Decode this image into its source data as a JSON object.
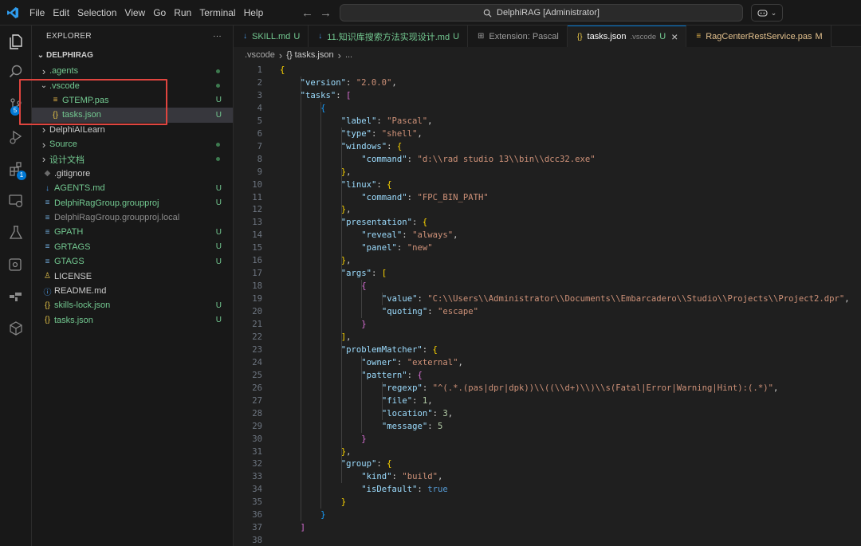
{
  "titlebar": {
    "menu": [
      "File",
      "Edit",
      "Selection",
      "View",
      "Go",
      "Run",
      "Terminal",
      "Help"
    ],
    "search_text": "DelphiRAG [Administrator]"
  },
  "activity_bar": {
    "source_control_badge": "5",
    "extensions_badge": "1"
  },
  "sidebar": {
    "title": "EXPLORER",
    "more_label": "···",
    "root": "DELPHIRAG",
    "items": [
      {
        "label": ".agents",
        "kind": "folder",
        "expanded": false,
        "indent": 0,
        "color": "#73c991",
        "status": "dot"
      },
      {
        "label": ".vscode",
        "kind": "folder",
        "expanded": true,
        "indent": 0,
        "color": "#73c991",
        "status": "dot"
      },
      {
        "label": "GTEMP.pas",
        "kind": "pas",
        "indent": 1,
        "color": "#73c991",
        "status": "U"
      },
      {
        "label": "tasks.json",
        "kind": "json",
        "indent": 1,
        "color": "#73c991",
        "status": "U",
        "selected": true
      },
      {
        "label": "DelphiAILearn",
        "kind": "folder",
        "expanded": false,
        "indent": 0,
        "color": "#cccccc",
        "status": ""
      },
      {
        "label": "Source",
        "kind": "folder",
        "expanded": false,
        "indent": 0,
        "color": "#73c991",
        "status": "dot"
      },
      {
        "label": "设计文档",
        "kind": "folder",
        "expanded": false,
        "indent": 0,
        "color": "#73c991",
        "status": "dot"
      },
      {
        "label": ".gitignore",
        "kind": "gitignore",
        "indent": 0,
        "color": "#cccccc",
        "status": ""
      },
      {
        "label": "AGENTS.md",
        "kind": "md",
        "indent": 0,
        "color": "#73c991",
        "status": "U"
      },
      {
        "label": "DelphiRagGroup.groupproj",
        "kind": "proj",
        "indent": 0,
        "color": "#73c991",
        "status": "U"
      },
      {
        "label": "DelphiRagGroup.groupproj.local",
        "kind": "file",
        "indent": 0,
        "color": "#8c8c8c",
        "status": ""
      },
      {
        "label": "GPATH",
        "kind": "file",
        "indent": 0,
        "color": "#73c991",
        "status": "U"
      },
      {
        "label": "GRTAGS",
        "kind": "file",
        "indent": 0,
        "color": "#73c991",
        "status": "U"
      },
      {
        "label": "GTAGS",
        "kind": "file",
        "indent": 0,
        "color": "#73c991",
        "status": "U"
      },
      {
        "label": "LICENSE",
        "kind": "license",
        "indent": 0,
        "color": "#cccccc",
        "status": ""
      },
      {
        "label": "README.md",
        "kind": "info",
        "indent": 0,
        "color": "#cccccc",
        "status": ""
      },
      {
        "label": "skills-lock.json",
        "kind": "json",
        "indent": 0,
        "color": "#73c991",
        "status": "U"
      },
      {
        "label": "tasks.json",
        "kind": "json",
        "indent": 0,
        "color": "#73c991",
        "status": "U"
      }
    ]
  },
  "tabs": [
    {
      "label": "SKILL.md",
      "status": "U",
      "icon": "md",
      "status_color": "#73c991",
      "label_color": "#73c991"
    },
    {
      "label": "11.知识库搜索方法实现设计.md",
      "status": "U",
      "icon": "md",
      "status_color": "#73c991",
      "label_color": "#73c991"
    },
    {
      "label": "Extension: Pascal",
      "status": "",
      "icon": "ext",
      "status_color": "",
      "label_color": "#9d9d9d"
    },
    {
      "label": "tasks.json",
      "description": ".vscode",
      "status": "U",
      "icon": "json",
      "active": true,
      "status_color": "#73c991",
      "label_color": "#ffffff"
    },
    {
      "label": "RagCenterRestService.pas",
      "status": "M",
      "icon": "pas",
      "status_color": "#e2c08d",
      "label_color": "#e2c08d"
    }
  ],
  "breadcrumb": [
    ".vscode",
    "{} tasks.json",
    "..."
  ],
  "code_lines": [
    "{",
    "    \"version\": \"2.0.0\",",
    "    \"tasks\": [",
    "        {",
    "            \"label\": \"Pascal\",",
    "            \"type\": \"shell\",",
    "            \"windows\": {",
    "                \"command\": \"d:\\\\rad studio 13\\\\bin\\\\dcc32.exe\"",
    "            },",
    "            \"linux\": {",
    "                \"command\": \"FPC_BIN_PATH\"",
    "            },",
    "            \"presentation\": {",
    "                \"reveal\": \"always\",",
    "                \"panel\": \"new\"",
    "            },",
    "            \"args\": [",
    "                {",
    "                    \"value\": \"C:\\\\Users\\\\Administrator\\\\Documents\\\\Embarcadero\\\\Studio\\\\Projects\\\\Project2.dpr\",",
    "                    \"quoting\": \"escape\"",
    "                }",
    "            ],",
    "            \"problemMatcher\": {",
    "                \"owner\": \"external\",",
    "                \"pattern\": {",
    "                    \"regexp\": \"^(.*.(pas|dpr|dpk))\\\\((\\\\d+)\\\\)\\\\s(Fatal|Error|Warning|Hint):(.*)\",",
    "                    \"file\": 1,",
    "                    \"location\": 3,",
    "                    \"message\": 5",
    "                }",
    "            },",
    "            \"group\": {",
    "                \"kind\": \"build\",",
    "                \"isDefault\": true",
    "            }",
    "        }",
    "    ]",
    ""
  ],
  "colors": {
    "accent": "#0078d4",
    "untracked": "#73c991",
    "modified": "#e2c08d",
    "highlight_box": "#e0453f"
  }
}
